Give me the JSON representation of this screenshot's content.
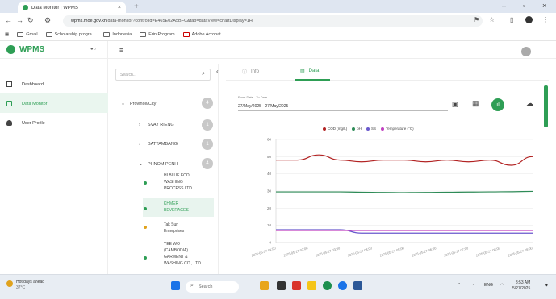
{
  "browser": {
    "tab_title": "Data Monitor | WPMS",
    "tab_close": "×",
    "new_tab": "+",
    "url_host": "wpms.moe.gov.kh",
    "url_path": "/data-monitor?controlId=E465E02A5BFC&tab=dataView=chartDisplay=1H",
    "bookmarks": [
      "Gmail",
      "Scholarship progra...",
      "Indonesia",
      "Erin Program",
      "Adobe Acrobat"
    ],
    "window_min": "–",
    "window_close": "×"
  },
  "app": {
    "brand": "WPMS",
    "nav": [
      {
        "label": "Dashboard"
      },
      {
        "label": "Data Monitor"
      },
      {
        "label": "User Profile"
      }
    ]
  },
  "tree": {
    "search_placeholder": "Search...",
    "root": "Province/City",
    "root_count": "4",
    "provinces": [
      {
        "label": "SVAY RIENG",
        "count": "1"
      },
      {
        "label": "BATTAMBANG",
        "count": "1"
      },
      {
        "label": "PHNOM PENH",
        "count": "4"
      }
    ],
    "facilities": [
      {
        "label": "HI BLUE ECO\nWASHING\nPROCESS LTD",
        "color": "#2e9e55"
      },
      {
        "label": "KHMER\nBEVERAGES",
        "color": "#2e9e55"
      },
      {
        "label": "Tak Sun\nEnterprises",
        "color": "#e0a21c"
      },
      {
        "label": "YEE WO\n(CAMBODIA)\nGARMENT &\nWASHING CO., LTD",
        "color": "#2e9e55"
      }
    ]
  },
  "main": {
    "tab_info": "Info",
    "tab_data": "Data",
    "date_label": "From Date - To Date",
    "date_value": "27/May/2025 - 27/May/2025"
  },
  "chart_data": {
    "type": "line",
    "legend": [
      "COD (mg/L)",
      "pH",
      "SS",
      "Temperature (°C)"
    ],
    "colors": [
      "#b22222",
      "#2e8b57",
      "#6a5acd",
      "#c040c0"
    ],
    "x": [
      "2025-05-27 01:00",
      "2025-05-27 02:00",
      "2025-05-27 03:00",
      "2025-05-27 04:00",
      "2025-05-27 05:00",
      "2025-05-27 06:00",
      "2025-05-27 07:00",
      "2025-05-27 08:00",
      "2025-05-27 09:00"
    ],
    "series": [
      {
        "name": "COD (mg/L)",
        "values": [
          48,
          48,
          51,
          48,
          47,
          48,
          48,
          47,
          48,
          47,
          48,
          45,
          50
        ]
      },
      {
        "name": "pH",
        "values": [
          29.5,
          29.5,
          29.5,
          29.5,
          29.3,
          29.2,
          29.1,
          29.2,
          29.3,
          29.4,
          29.5,
          29.6,
          29.8
        ]
      },
      {
        "name": "SS",
        "values": [
          7.5,
          7.5,
          7.5,
          7.5,
          5.5,
          5.5,
          5.5,
          5.5,
          5.5,
          5.5,
          5.5,
          5.5,
          5.5
        ]
      },
      {
        "name": "Temperature (°C)",
        "values": [
          7,
          7,
          7,
          7,
          7,
          7,
          7,
          7,
          7,
          7,
          7,
          7,
          7
        ]
      }
    ],
    "yticks": [
      0,
      10,
      20,
      30,
      40,
      50,
      60
    ],
    "ylim": [
      0,
      60
    ],
    "grid": true,
    "legend_position": "top"
  },
  "taskbar": {
    "weather_title": "Hot days ahead",
    "weather_temp": "37°C",
    "search": "Search",
    "lang": "ENG",
    "time": "8:53 AM",
    "date": "5/27/2025"
  }
}
